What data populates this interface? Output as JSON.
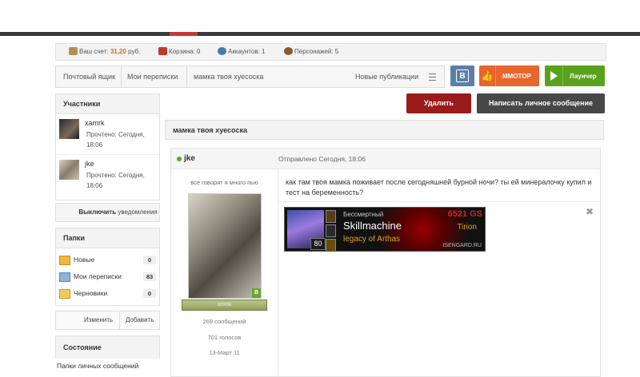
{
  "account_bar": {
    "balance_label": "Ваш счет:",
    "balance_value": "31,20",
    "balance_currency": "руб.",
    "cart": "Корзина: 0",
    "accounts": "Аккаунтов: 1",
    "characters": "Персонажей: 5"
  },
  "breadcrumbs": [
    "Почтовый ящик",
    "Мои переписки",
    "мамка твоя хуесоска"
  ],
  "new_publications": "Новые публикации",
  "buttons": {
    "vk": "В",
    "mmotop": "ММОТОР",
    "launcher": "Лаунчер",
    "delete": "Удалить",
    "write": "Написать личное сообщение"
  },
  "participants": {
    "title": "Участники",
    "members": [
      {
        "name": "xamrk",
        "status": "Прочтено: Сегодня, 18:06"
      },
      {
        "name": "jke",
        "status": "Прочтено: Сегодня, 18:06"
      }
    ]
  },
  "notify": {
    "action": "Выключить",
    "text": "уведомления"
  },
  "folders": {
    "title": "Папки",
    "items": [
      {
        "label": "Новые",
        "count": "0"
      },
      {
        "label": "Мои переписки",
        "count": "83"
      },
      {
        "label": "Черновики",
        "count": "0"
      }
    ],
    "edit": "Изменить",
    "add": "Добавить"
  },
  "state": {
    "title": "Состояние",
    "subtitle": "Папки личных сообщений"
  },
  "thread": {
    "title": "мамка твоя хуесоска"
  },
  "post": {
    "author": "jke",
    "sent": "Отправлено Сегодня, 18:06",
    "user_title": "все говорят я много пью",
    "avatar_badge": "B",
    "rank": "ШТРОК",
    "messages": "269 сообщений",
    "votes": "701 голосов",
    "joined": "13-Март 11",
    "text": "как там твоя мамка поживает после сегодняшней бурной ночи? ты ей минералочку купил и тест на беременность?",
    "close": "✖"
  },
  "banner": {
    "rank": "Бессмертный",
    "name": "Skillmachine",
    "guild": "legacy of Arthas",
    "gear_score": "6521 GS",
    "realm": "Tirion",
    "level": "80",
    "site": "ISENGARD.RU"
  },
  "colors": {
    "balance": "#e26b10",
    "delete": "#9b1a1a",
    "write": "#474747",
    "vk": "#5b7fa6",
    "mmotop": "#e8652b",
    "launcher": "#5aa21d",
    "online": "#4caf2a"
  }
}
